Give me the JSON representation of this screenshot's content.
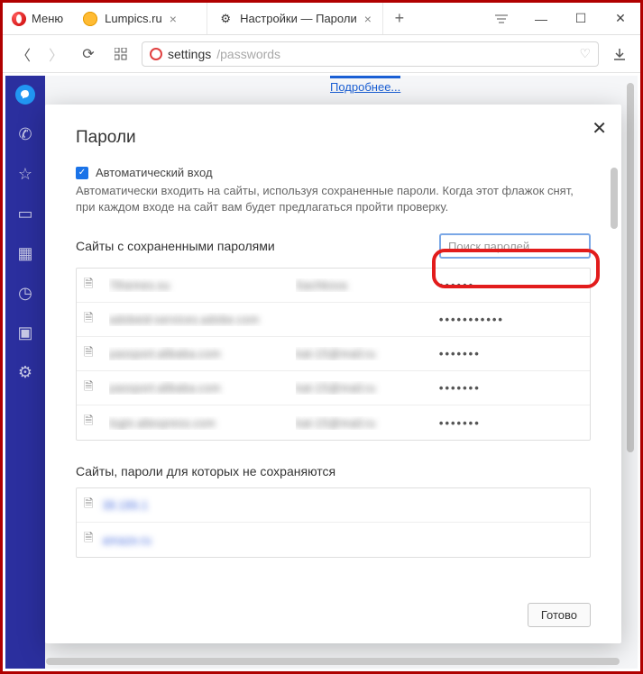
{
  "titlebar": {
    "menu_label": "Меню",
    "tabs": [
      {
        "label": "Lumpics.ru"
      },
      {
        "label": "Настройки — Пароли"
      }
    ]
  },
  "address": {
    "prefix": "settings",
    "path": "/passwords"
  },
  "settings_bg": {
    "link": "Подробнее..."
  },
  "modal": {
    "title": "Пароли",
    "auto_label": "Автоматический вход",
    "auto_desc": "Автоматически входить на сайты, используя сохраненные пароли. Когда этот флажок снят, при каждом входе на сайт вам будет предлагаться пройти проверку.",
    "saved_title": "Сайты с сохраненными паролями",
    "search_placeholder": "Поиск паролей",
    "saved": [
      {
        "site": "7themes.su",
        "user": "Sachkova",
        "pw": "••••••"
      },
      {
        "site": "adobeid-services.adobe.com",
        "user": "",
        "pw": "•••••••••••"
      },
      {
        "site": "passport.alibaba.com",
        "user": "kat-15@mail.ru",
        "pw": "•••••••"
      },
      {
        "site": "passport.alibaba.com",
        "user": "kat-15@mail.ru",
        "pw": "•••••••"
      },
      {
        "site": "login.aliexpress.com",
        "user": "kat-15@mail.ru",
        "pw": "•••••••"
      }
    ],
    "never_title": "Сайты, пароли для которых не сохраняются",
    "never": [
      {
        "site": "38.186.1"
      },
      {
        "site": "amaze.ru"
      }
    ],
    "done": "Готово"
  }
}
